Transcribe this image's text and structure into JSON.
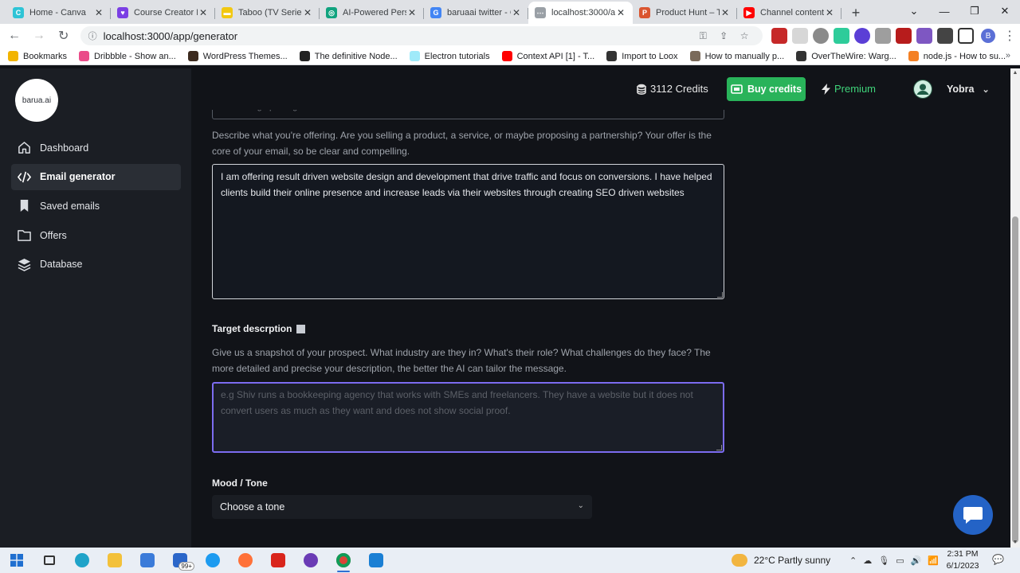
{
  "browser": {
    "tabs": [
      {
        "title": "Home - Canva",
        "color": "#2ec4d6",
        "glyph": "C"
      },
      {
        "title": "Course Creator Lo",
        "color": "#7b3fe4",
        "glyph": "♥"
      },
      {
        "title": "Taboo (TV Series",
        "color": "#f2c811",
        "glyph": "▬"
      },
      {
        "title": "AI-Powered Perso",
        "color": "#10a37f",
        "glyph": "◎"
      },
      {
        "title": "baruaai twitter - G",
        "color": "#4285f4",
        "glyph": "G"
      },
      {
        "title": "localhost:3000/ap",
        "color": "#9aa0a6",
        "glyph": "⋯",
        "active": true
      },
      {
        "title": "Product Hunt – T",
        "color": "#da552f",
        "glyph": "P"
      },
      {
        "title": "Channel content",
        "color": "#ff0000",
        "glyph": "▶"
      }
    ],
    "url": "localhost:3000/app/generator",
    "bookmarks": [
      {
        "label": "Bookmarks",
        "color": "#f2b400"
      },
      {
        "label": "Dribbble - Show an...",
        "color": "#ea4c89"
      },
      {
        "label": "WordPress Themes...",
        "color": "#3d2b1f"
      },
      {
        "label": "The definitive Node...",
        "color": "#222222"
      },
      {
        "label": "Electron tutorials",
        "color": "#9feaf9"
      },
      {
        "label": "Context API [1] - T...",
        "color": "#ff0000"
      },
      {
        "label": "Import to Loox",
        "color": "#333333"
      },
      {
        "label": "How to manually p...",
        "color": "#7a6a5a"
      },
      {
        "label": "OverTheWire: Warg...",
        "color": "#333333"
      },
      {
        "label": "node.js - How to su...",
        "color": "#f48024"
      }
    ],
    "profile_initial": "B"
  },
  "sidebar": {
    "logo": "barua.ai",
    "items": [
      {
        "label": "Dashboard",
        "icon": "home-icon"
      },
      {
        "label": "Email generator",
        "icon": "code-icon",
        "active": true
      },
      {
        "label": "Saved emails",
        "icon": "bookmark-icon"
      },
      {
        "label": "Offers",
        "icon": "folder-icon"
      },
      {
        "label": "Database",
        "icon": "layers-icon"
      }
    ]
  },
  "topbar": {
    "credits": "3112 Credits",
    "buy_label": "Buy credits",
    "premium_label": "Premium",
    "user_name": "Yobra"
  },
  "form": {
    "prev_field_value": "Web design package",
    "offer_description": "Describe what you're offering. Are you selling a product, a service, or maybe proposing a partnership? Your offer is the core of your email, so be clear and compelling.",
    "offer_text": "I am offering result driven website design and development that drive traffic and focus on conversions. I have helped clients build their online presence and increase leads via their websites through creating SEO driven websites",
    "target_label": "Target descrption",
    "target_description": "Give us a snapshot of your prospect. What industry are they in? What's their role? What challenges do they face? The more detailed and precise your description, the better the AI can tailor the message.",
    "target_placeholder": "e.g Shiv runs a bookkeeping agency that works with SMEs and freelancers. They have a website but it does not convert users as much as they want and does not show social proof.",
    "tone_label": "Mood / Tone",
    "tone_value": "Choose a tone"
  },
  "taskbar": {
    "mail_badge": "99+",
    "weather": "22°C  Partly sunny",
    "time": "2:31 PM",
    "date": "6/1/2023"
  }
}
